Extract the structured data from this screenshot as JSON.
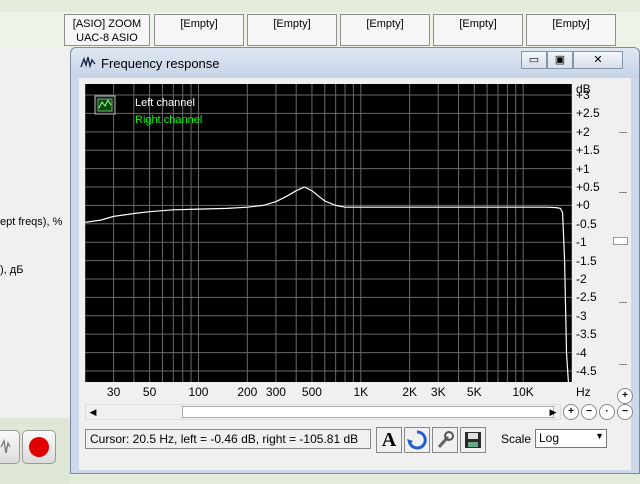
{
  "devices": [
    {
      "label_line1": "[ASIO] ZOOM",
      "label_line2": "UAC-8 ASIO"
    },
    {
      "label_line1": "[Empty]",
      "label_line2": ""
    },
    {
      "label_line1": "[Empty]",
      "label_line2": ""
    },
    {
      "label_line1": "[Empty]",
      "label_line2": ""
    },
    {
      "label_line1": "[Empty]",
      "label_line2": ""
    },
    {
      "label_line1": "[Empty]",
      "label_line2": ""
    }
  ],
  "background": {
    "text1": "ept freqs), %",
    "text2": "), дБ"
  },
  "window": {
    "title": "Frequency response",
    "minimize": "▭",
    "restore": "▣",
    "close": "✕"
  },
  "legend": {
    "left": "Left channel",
    "right": "Right channel"
  },
  "y_axis": {
    "unit": "dB",
    "ticks": [
      "+3",
      "+2.5",
      "+2",
      "+1.5",
      "+1",
      "+0.5",
      "+0",
      "-0.5",
      "-1",
      "-1.5",
      "-2",
      "-2.5",
      "-3",
      "-3.5",
      "-4",
      "-4.5"
    ],
    "tick_values": [
      3,
      2.5,
      2,
      1.5,
      1,
      0.5,
      0,
      -0.5,
      -1,
      -1.5,
      -2,
      -2.5,
      -3,
      -3.5,
      -4,
      -4.5
    ]
  },
  "x_axis": {
    "unit": "Hz",
    "ticks": [
      "30",
      "50",
      "100",
      "200",
      "300",
      "500",
      "1K",
      "2K",
      "3K",
      "5K",
      "10K"
    ],
    "tick_values": [
      30,
      50,
      100,
      200,
      300,
      500,
      1000,
      2000,
      3000,
      5000,
      10000
    ]
  },
  "status": {
    "cursor": "Cursor:  20.5 Hz,  left = -0.46 dB,  right = -105.81 dB"
  },
  "toolbar": {
    "font_btn": "A",
    "scale_label": "Scale",
    "scale_value": "Log"
  },
  "colors": {
    "plot_bg": "#000000",
    "left_channel": "#ffffff",
    "right_channel": "#00ff00",
    "grid": "#6a6a6a"
  },
  "chart_data": {
    "type": "line",
    "x_scale": "log",
    "xlim": [
      20,
      20000
    ],
    "ylim": [
      -4.8,
      3.3
    ],
    "ylabel": "dB",
    "xlabel": "Hz",
    "series": [
      {
        "name": "Left channel",
        "color": "#ffffff",
        "x": [
          20,
          25,
          30,
          40,
          50,
          70,
          100,
          150,
          200,
          250,
          300,
          350,
          400,
          450,
          500,
          550,
          600,
          700,
          800,
          1000,
          1500,
          2000,
          3000,
          5000,
          7000,
          10000,
          12000,
          14000,
          16000,
          17000,
          17500,
          18000,
          18500,
          19000
        ],
        "y": [
          -0.46,
          -0.4,
          -0.3,
          -0.22,
          -0.17,
          -0.12,
          -0.1,
          -0.08,
          -0.05,
          0.0,
          0.1,
          0.25,
          0.4,
          0.5,
          0.4,
          0.25,
          0.12,
          0.0,
          -0.05,
          -0.05,
          -0.05,
          -0.05,
          -0.05,
          -0.05,
          -0.05,
          -0.05,
          -0.05,
          -0.05,
          -0.06,
          -0.08,
          -0.2,
          -1.5,
          -4.0,
          -4.8
        ]
      },
      {
        "name": "Right channel",
        "color": "#00ff00",
        "x": [],
        "y": []
      }
    ]
  }
}
